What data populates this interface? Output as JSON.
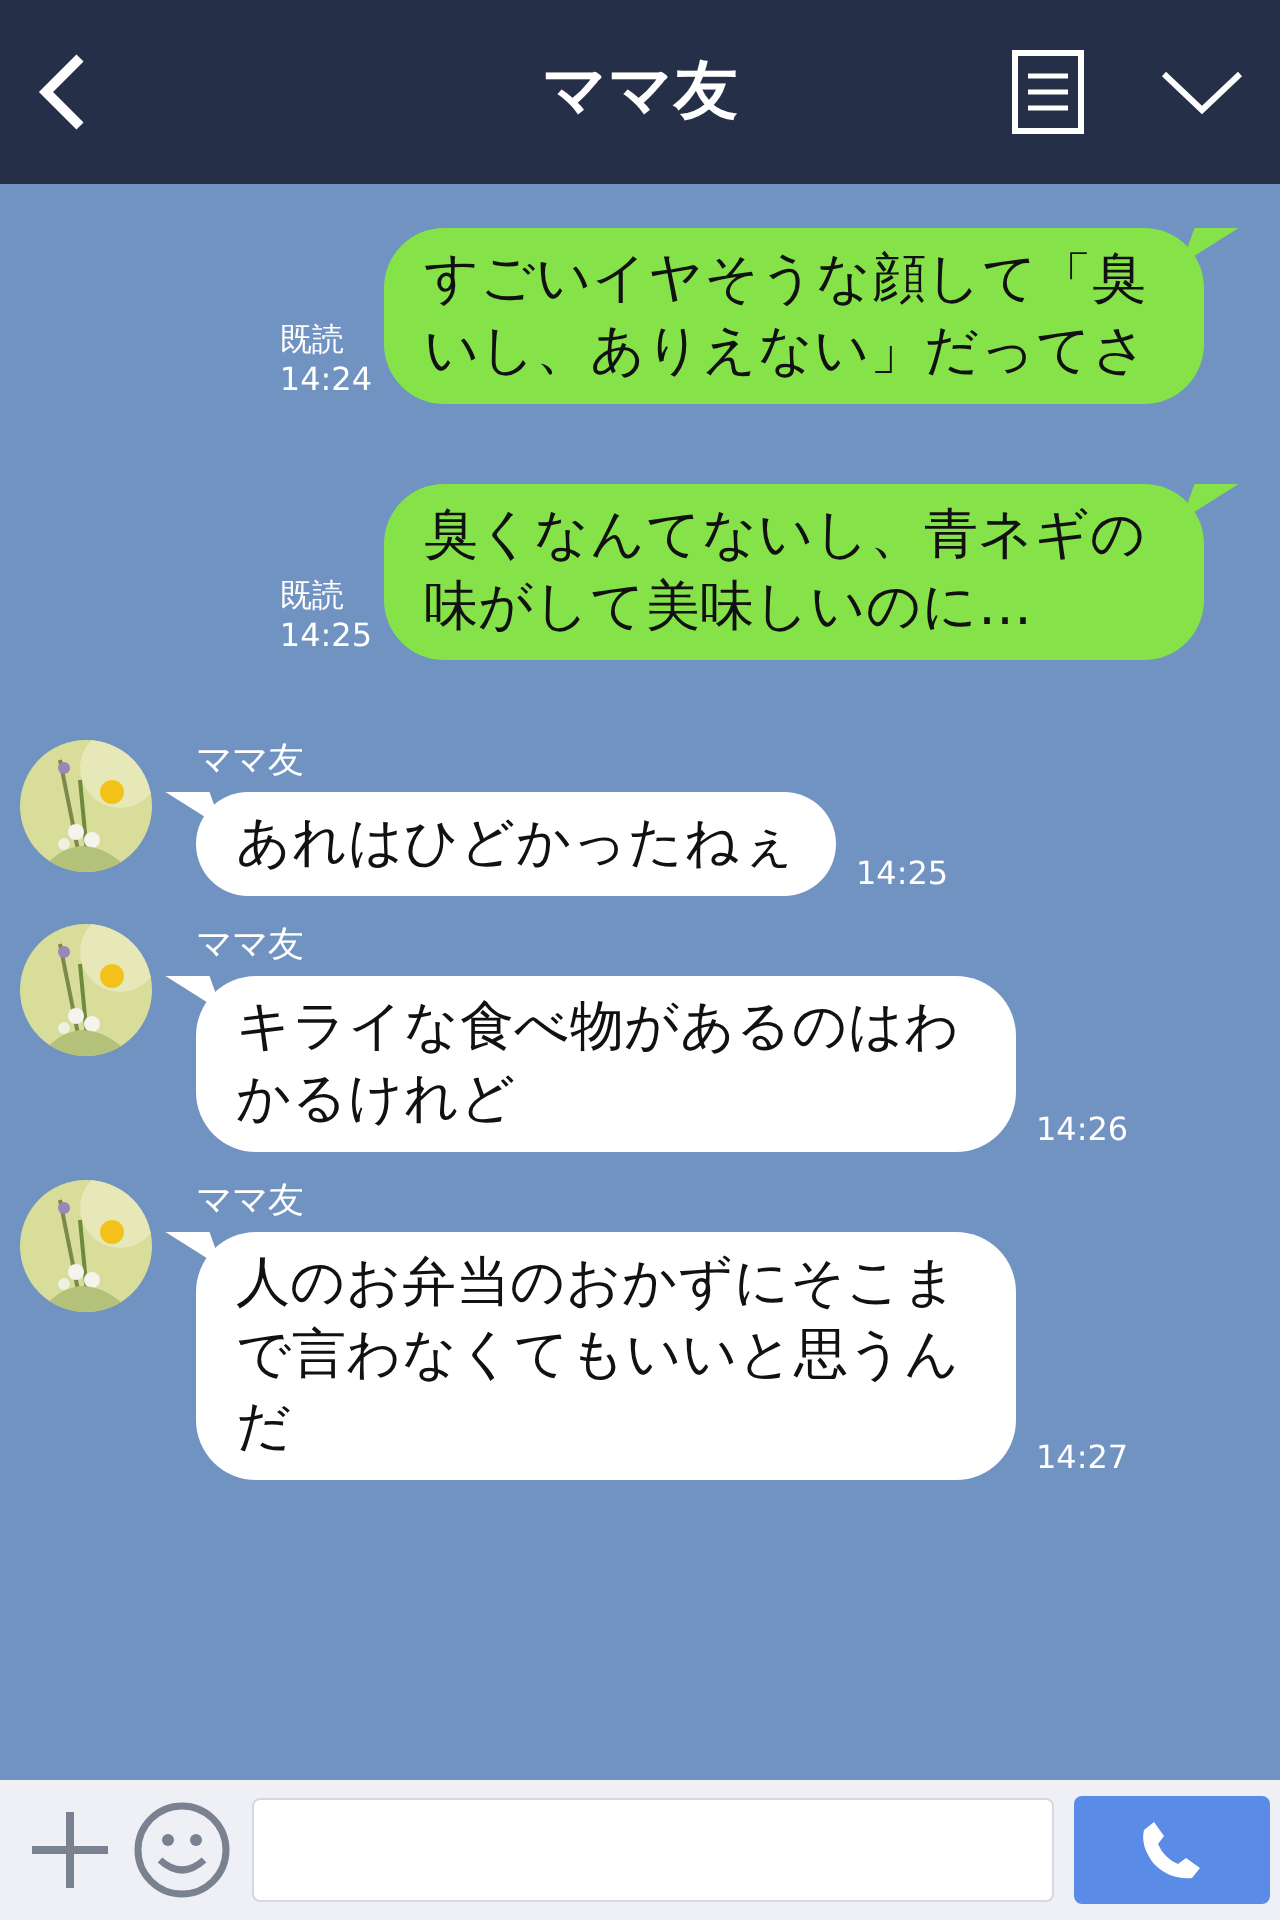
{
  "header": {
    "title": "ママ友"
  },
  "messages": [
    {
      "kind": "sent",
      "text": "すごいイヤそうな顔して「臭いし、ありえない」だってさ",
      "read": "既読",
      "time": "14:24"
    },
    {
      "kind": "sent",
      "text": "臭くなんてないし、青ネギの味がして美味しいのに…",
      "read": "既読",
      "time": "14:25"
    },
    {
      "kind": "received",
      "sender": "ママ友",
      "text": "あれはひどかったねぇ",
      "time": "14:25"
    },
    {
      "kind": "received",
      "sender": "ママ友",
      "text": "キライな食べ物があるのはわかるけれど",
      "time": "14:26"
    },
    {
      "kind": "received",
      "sender": "ママ友",
      "text": "人のお弁当のおかずにそこまで言わなくてもいいと思うんだ",
      "time": "14:27"
    }
  ]
}
